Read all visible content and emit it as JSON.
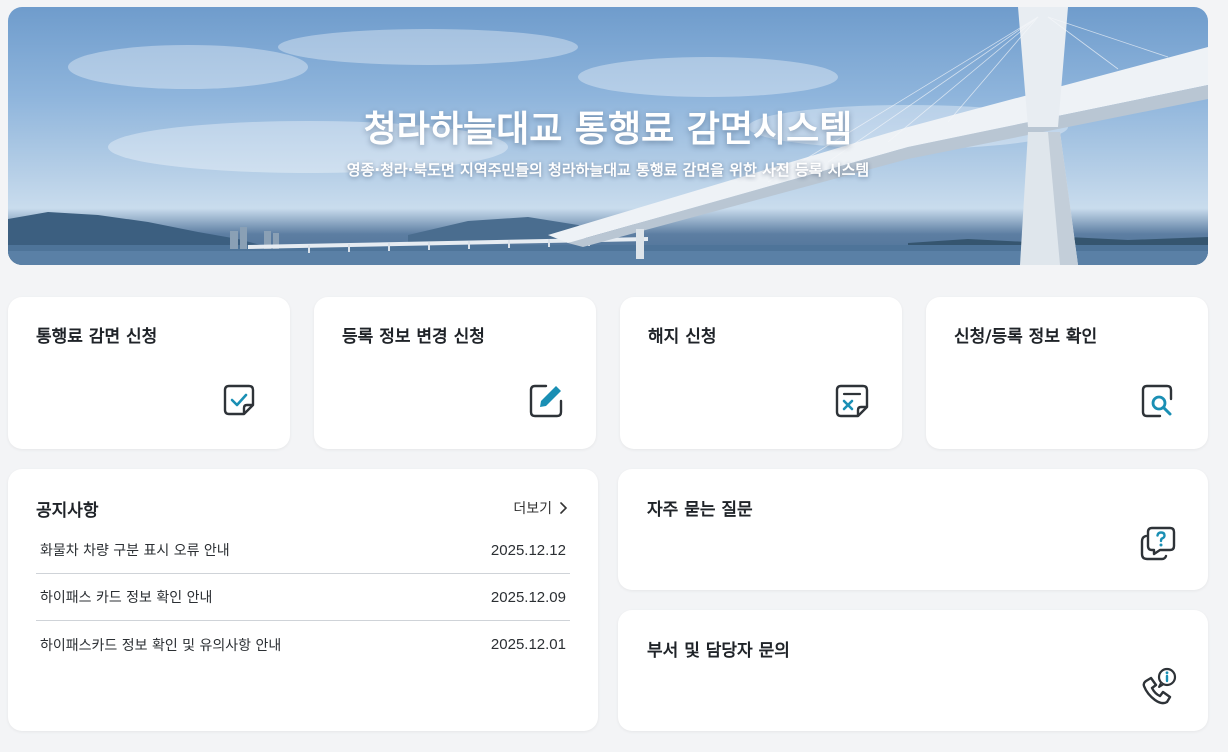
{
  "hero": {
    "title": "청라하늘대교 통행료 감면시스템",
    "subtitle": "영종·청라·북도면 지역주민들의 청라하늘대교 통행료 감면을 위한 사전 등록 시스템"
  },
  "menu": [
    {
      "label": "통행료 감면 신청",
      "icon": "check-document-icon"
    },
    {
      "label": "등록 정보 변경 신청",
      "icon": "edit-pencil-icon"
    },
    {
      "label": "해지 신청",
      "icon": "cancel-document-icon"
    },
    {
      "label": "신청/등록 정보 확인",
      "icon": "search-document-icon"
    }
  ],
  "notice": {
    "title": "공지사항",
    "more_label": "더보기",
    "items": [
      {
        "title": "화물차 차량 구분 표시 오류 안내",
        "date": "2025.12.12"
      },
      {
        "title": "하이패스 카드 정보 확인 안내",
        "date": "2025.12.09"
      },
      {
        "title": "하이패스카드 정보 확인 및 유의사항 안내",
        "date": "2025.12.01"
      }
    ]
  },
  "faq": {
    "label": "자주 묻는 질문",
    "icon": "question-bubble-icon"
  },
  "contact": {
    "label": "부서 및 담당자 문의",
    "icon": "phone-info-icon"
  },
  "colors": {
    "accent": "#1a8fb4",
    "icon_stroke": "#2e3338",
    "background": "#f3f4f6"
  }
}
